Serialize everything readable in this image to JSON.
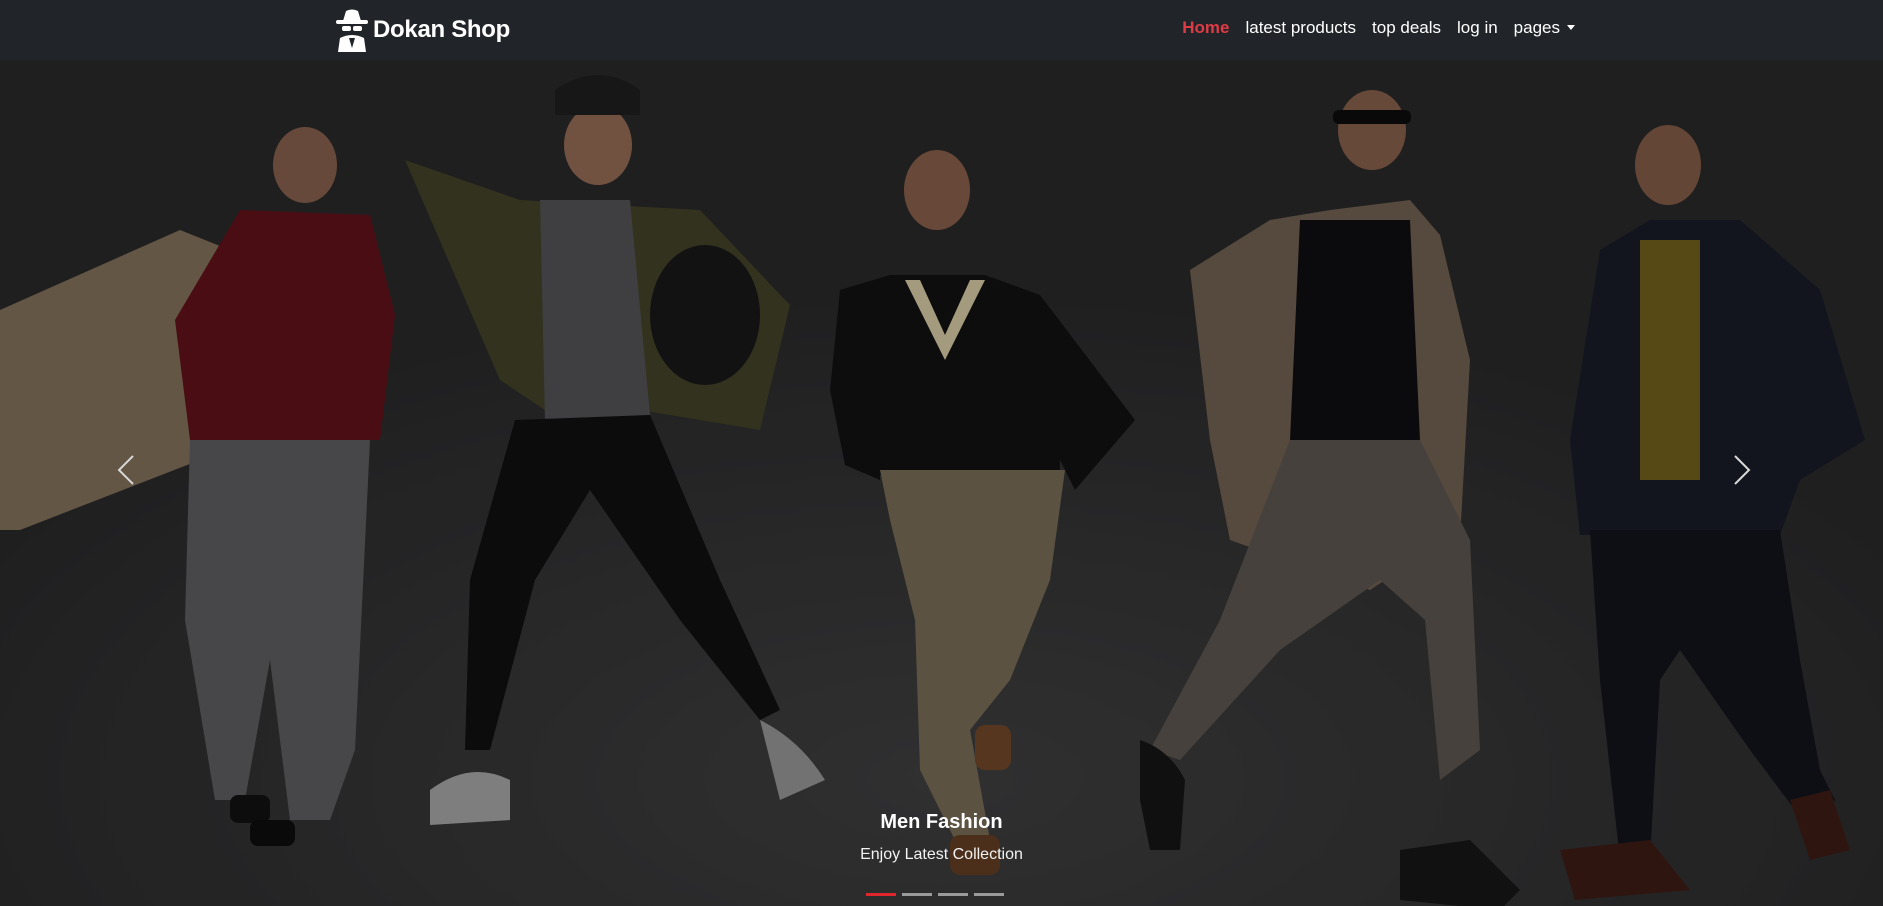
{
  "brand": {
    "name": "Dokan Shop",
    "logo_icon": "spy-hat-icon"
  },
  "nav": {
    "items": [
      {
        "label": "Home",
        "active": true
      },
      {
        "label": "latest products",
        "active": false
      },
      {
        "label": "top deals",
        "active": false
      },
      {
        "label": "log in",
        "active": false
      },
      {
        "label": "pages",
        "active": false,
        "dropdown": true
      }
    ]
  },
  "carousel": {
    "caption_title": "Men Fashion",
    "caption_text": "Enjoy Latest Collection",
    "slide_count": 4,
    "active_slide": 1,
    "prev_icon": "chevron-left-icon",
    "next_icon": "chevron-right-icon"
  },
  "colors": {
    "navbar_bg": "#212529",
    "active_link": "#e03b45",
    "indicator_active": "#e0262d",
    "indicator_inactive": "#9a9a9a"
  }
}
